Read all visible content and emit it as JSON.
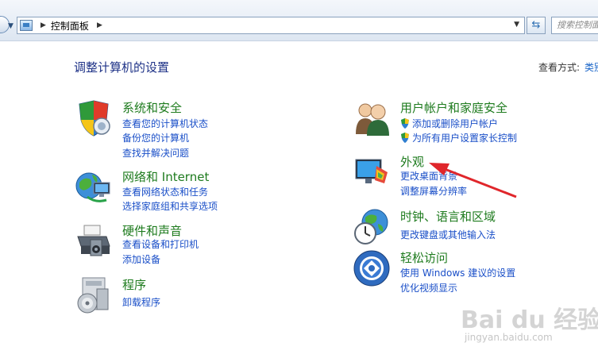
{
  "address_bar": {
    "path": "控制面板",
    "search_placeholder": "搜索控制面板"
  },
  "main": {
    "title": "调整计算机的设置",
    "view_by_label": "查看方式:",
    "view_by_value": "类别"
  },
  "categories": {
    "system": {
      "title": "系统和安全",
      "links": [
        "查看您的计算机状态",
        "备份您的计算机",
        "查找并解决问题"
      ]
    },
    "network": {
      "title": "网络和 Internet",
      "links": [
        "查看网络状态和任务",
        "选择家庭组和共享选项"
      ]
    },
    "hardware": {
      "title": "硬件和声音",
      "links": [
        "查看设备和打印机",
        "添加设备"
      ]
    },
    "programs": {
      "title": "程序",
      "links": [
        "卸载程序"
      ]
    },
    "users": {
      "title": "用户帐户和家庭安全",
      "links": [
        "添加或删除用户帐户",
        "为所有用户设置家长控制"
      ]
    },
    "appearance": {
      "title": "外观",
      "links": [
        "更改桌面背景",
        "调整屏幕分辨率"
      ]
    },
    "clock": {
      "title": "时钟、语言和区域",
      "links": [
        "更改键盘或其他输入法"
      ]
    },
    "ease": {
      "title": "轻松访问",
      "links": [
        "使用 Windows 建议的设置",
        "优化视频显示"
      ]
    }
  },
  "watermark": {
    "text": "Bai du 经验",
    "sub": "jingyan.baidu.com"
  },
  "colors": {
    "title_blue": "#1e3287",
    "category_green": "#1e7b1e",
    "link_blue": "#1a4fc8",
    "arrow_red": "#e0262b"
  },
  "icons": [
    "shield-icon",
    "network-icon",
    "printer-icon",
    "programs-icon",
    "users-icon",
    "appearance-icon",
    "clock-globe-icon",
    "ease-of-access-icon",
    "refresh-icon",
    "control-panel-icon"
  ]
}
